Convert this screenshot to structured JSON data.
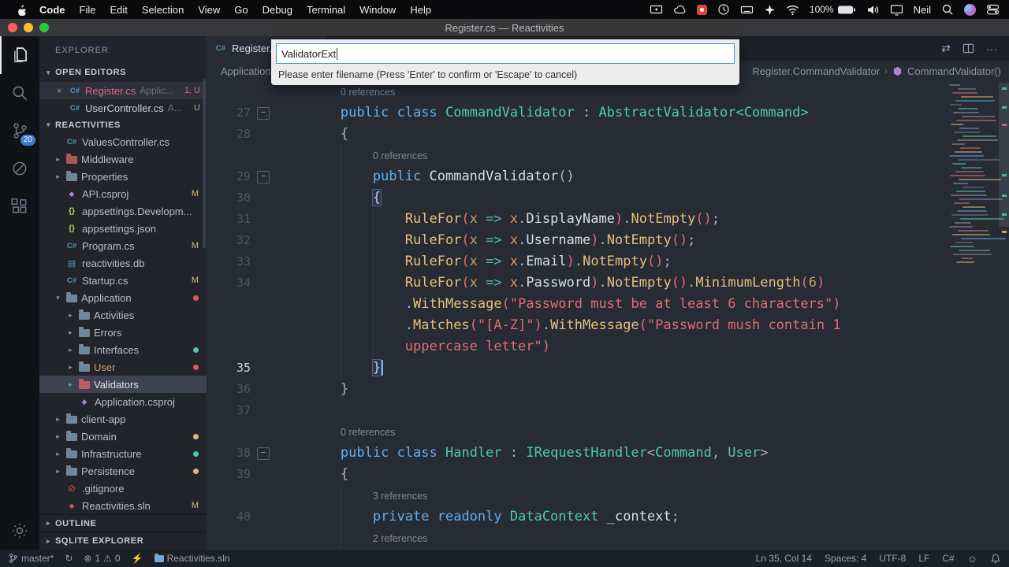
{
  "window": {
    "title": "Register.cs — Reactivities"
  },
  "menu_bar": {
    "items": [
      "Code",
      "File",
      "Edit",
      "Selection",
      "View",
      "Go",
      "Debug",
      "Terminal",
      "Window",
      "Help"
    ],
    "battery": "100%",
    "user": "Neil"
  },
  "activity_bar": {
    "source_control_badge": "20"
  },
  "sidebar": {
    "header": "EXPLORER",
    "sections": {
      "open_editors": "OPEN EDITORS",
      "workspace": "REACTIVITIES",
      "outline": "OUTLINE",
      "sqlite": "SQLITE EXPLORER"
    },
    "open_editors": [
      {
        "label": "Register.cs",
        "desc": "Applic...",
        "badge": "1, U",
        "type": "cs",
        "active": true,
        "color": "#e0697a",
        "badge_color": "#e0697a"
      },
      {
        "label": "UserController.cs",
        "desc": "A...",
        "badge": "U",
        "type": "cs",
        "active": false,
        "badge_color": "#73c991"
      }
    ],
    "tree": [
      {
        "label": "ValuesController.cs",
        "type": "cs",
        "level": 0
      },
      {
        "label": "Middleware",
        "type": "folder",
        "chev": "r",
        "level": 0,
        "ic": "#a9595c"
      },
      {
        "label": "Properties",
        "type": "folder",
        "chev": "r",
        "level": 0
      },
      {
        "label": "API.csproj",
        "type": "csproj",
        "level": 0,
        "badge": "M"
      },
      {
        "label": "appsettings.Developm...",
        "type": "json",
        "level": 0
      },
      {
        "label": "appsettings.json",
        "type": "json",
        "level": 0
      },
      {
        "label": "Program.cs",
        "type": "cs",
        "level": 0,
        "badge": "M"
      },
      {
        "label": "reactivities.db",
        "type": "db",
        "level": 0
      },
      {
        "label": "Startup.cs",
        "type": "cs",
        "level": 0,
        "badge": "M"
      },
      {
        "label": "Application",
        "type": "folder",
        "chev": "d",
        "level": 0,
        "dot": "#e05561"
      },
      {
        "label": "Activities",
        "type": "folder",
        "chev": "r",
        "level": 1
      },
      {
        "label": "Errors",
        "type": "folder",
        "chev": "r",
        "level": 1
      },
      {
        "label": "Interfaces",
        "type": "folder",
        "chev": "r",
        "level": 1,
        "dot": "#4ec9a8"
      },
      {
        "label": "User",
        "type": "folder",
        "chev": "r",
        "level": 1,
        "dot": "#e05561",
        "lc": "#d19a66"
      },
      {
        "label": "Validators",
        "type": "folder",
        "chev": "r",
        "level": 1,
        "sel": true,
        "ic": "#c45c66"
      },
      {
        "label": "Application.csproj",
        "type": "csproj",
        "level": 1
      },
      {
        "label": "client-app",
        "type": "folder",
        "chev": "r",
        "level": 0
      },
      {
        "label": "Domain",
        "type": "folder",
        "chev": "r",
        "level": 0,
        "dot": "#d7ba7d"
      },
      {
        "label": "Infrastructure",
        "type": "folder",
        "chev": "r",
        "level": 0,
        "dot": "#4ec9a8"
      },
      {
        "label": "Persistence",
        "type": "folder",
        "chev": "r",
        "level": 0,
        "dot": "#d7ba7d"
      },
      {
        "label": ".gitignore",
        "type": "git",
        "level": 0
      },
      {
        "label": "Reactivities.sln",
        "type": "sln",
        "level": 0,
        "badge": "M"
      }
    ]
  },
  "editor": {
    "tab": {
      "label": "Register.cs"
    },
    "breadcrumb": {
      "left": "Application",
      "right": "Register.CommandValidator",
      "method": "CommandValidator()"
    },
    "rows": [
      {
        "lens": "0 references",
        "ind": 8
      },
      {
        "n": "27",
        "fold": true,
        "segs": [
          [
            "        ",
            "pu"
          ],
          [
            "public",
            "kw"
          ],
          [
            " ",
            "pu"
          ],
          [
            "class",
            "kw"
          ],
          [
            " ",
            "pu"
          ],
          [
            "CommandValidator",
            "ty"
          ],
          [
            " : ",
            "pu"
          ],
          [
            "AbstractValidator<Command>",
            "ty"
          ]
        ]
      },
      {
        "n": "28",
        "segs": [
          [
            "        {",
            "pu"
          ]
        ]
      },
      {
        "lens": "0 references",
        "ind": 12
      },
      {
        "n": "29",
        "fold": true,
        "segs": [
          [
            "            ",
            "pu"
          ],
          [
            "public",
            "kw"
          ],
          [
            " ",
            "pu"
          ],
          [
            "CommandValidator",
            "tx"
          ],
          [
            "()",
            "pu"
          ]
        ]
      },
      {
        "n": "30",
        "segs": [
          [
            "            ",
            "pu"
          ],
          [
            "{",
            "bm"
          ]
        ]
      },
      {
        "n": "31",
        "segs": [
          [
            "                ",
            "pu"
          ],
          [
            "RuleFor",
            "fn"
          ],
          [
            "(",
            "pr"
          ],
          [
            "x",
            "va"
          ],
          [
            " ",
            "pu"
          ],
          [
            "=>",
            "op"
          ],
          [
            " ",
            "pu"
          ],
          [
            "x",
            "va"
          ],
          [
            ".",
            "pu"
          ],
          [
            "DisplayName",
            "tx"
          ],
          [
            ")",
            "pr"
          ],
          [
            ".",
            "pu"
          ],
          [
            "NotEmpty",
            "fn"
          ],
          [
            "()",
            "pr"
          ],
          [
            ";",
            "pu"
          ]
        ]
      },
      {
        "n": "32",
        "segs": [
          [
            "                ",
            "pu"
          ],
          [
            "RuleFor",
            "fn"
          ],
          [
            "(",
            "pr"
          ],
          [
            "x",
            "va"
          ],
          [
            " ",
            "pu"
          ],
          [
            "=>",
            "op"
          ],
          [
            " ",
            "pu"
          ],
          [
            "x",
            "va"
          ],
          [
            ".",
            "pu"
          ],
          [
            "Username",
            "tx"
          ],
          [
            ")",
            "pr"
          ],
          [
            ".",
            "pu"
          ],
          [
            "NotEmpty",
            "fn"
          ],
          [
            "()",
            "pr"
          ],
          [
            ";",
            "pu"
          ]
        ]
      },
      {
        "n": "33",
        "segs": [
          [
            "                ",
            "pu"
          ],
          [
            "RuleFor",
            "fn"
          ],
          [
            "(",
            "pr"
          ],
          [
            "x",
            "va"
          ],
          [
            " ",
            "pu"
          ],
          [
            "=>",
            "op"
          ],
          [
            " ",
            "pu"
          ],
          [
            "x",
            "va"
          ],
          [
            ".",
            "pu"
          ],
          [
            "Email",
            "tx"
          ],
          [
            ")",
            "pr"
          ],
          [
            ".",
            "pu"
          ],
          [
            "NotEmpty",
            "fn"
          ],
          [
            "()",
            "pr"
          ],
          [
            ";",
            "pu"
          ]
        ]
      },
      {
        "n": "34",
        "segs": [
          [
            "                ",
            "pu"
          ],
          [
            "RuleFor",
            "fn"
          ],
          [
            "(",
            "pr"
          ],
          [
            "x",
            "va"
          ],
          [
            " ",
            "pu"
          ],
          [
            "=>",
            "op"
          ],
          [
            " ",
            "pu"
          ],
          [
            "x",
            "va"
          ],
          [
            ".",
            "pu"
          ],
          [
            "Password",
            "tx"
          ],
          [
            ")",
            "pr"
          ],
          [
            ".",
            "pu"
          ],
          [
            "NotEmpty",
            "fn"
          ],
          [
            "()",
            "pr"
          ],
          [
            ".",
            "pu"
          ],
          [
            "MinimumLength",
            "fn"
          ],
          [
            "(",
            "pr"
          ],
          [
            "6",
            "nu"
          ],
          [
            ")",
            "pr"
          ]
        ]
      },
      {
        "segs": [
          [
            "                ",
            "pu"
          ],
          [
            ".",
            "pu"
          ],
          [
            "WithMessage",
            "fn"
          ],
          [
            "(",
            "pr"
          ],
          [
            "\"Password must be at least 6 characters\"",
            "st"
          ],
          [
            ")",
            "pr"
          ]
        ]
      },
      {
        "segs": [
          [
            "                ",
            "pu"
          ],
          [
            ".",
            "pu"
          ],
          [
            "Matches",
            "fn"
          ],
          [
            "(",
            "pr"
          ],
          [
            "\"[A-Z]\"",
            "st"
          ],
          [
            ")",
            "pr"
          ],
          [
            ".",
            "pu"
          ],
          [
            "WithMessage",
            "fn"
          ],
          [
            "(",
            "pr"
          ],
          [
            "\"Password mush contain 1",
            "st"
          ]
        ]
      },
      {
        "segs": [
          [
            "                ",
            "pu"
          ],
          [
            "uppercase letter\"",
            "st"
          ],
          [
            ")",
            "pr"
          ]
        ]
      },
      {
        "n": "35",
        "active": true,
        "seg_note": "cursor at col 14",
        "segs": [
          [
            "            ",
            "pu"
          ],
          [
            "}",
            "bm"
          ],
          [
            "",
            "cur"
          ]
        ]
      },
      {
        "n": "36",
        "segs": [
          [
            "        }",
            "pu"
          ]
        ]
      },
      {
        "n": "37",
        "segs": []
      },
      {
        "lens": "0 references",
        "ind": 8
      },
      {
        "n": "38",
        "fold": true,
        "segs": [
          [
            "        ",
            "pu"
          ],
          [
            "public",
            "kw"
          ],
          [
            " ",
            "pu"
          ],
          [
            "class",
            "kw"
          ],
          [
            " ",
            "pu"
          ],
          [
            "Handler",
            "ty"
          ],
          [
            " : ",
            "pu"
          ],
          [
            "IRequestHandler",
            "ty"
          ],
          [
            "<",
            "pu"
          ],
          [
            "Command",
            "ty"
          ],
          [
            ", ",
            "pu"
          ],
          [
            "User",
            "ty"
          ],
          [
            ">",
            "pu"
          ]
        ]
      },
      {
        "n": "39",
        "segs": [
          [
            "        {",
            "pu"
          ]
        ]
      },
      {
        "lens": "3 references",
        "ind": 12
      },
      {
        "n": "40",
        "segs": [
          [
            "            ",
            "pu"
          ],
          [
            "private",
            "kw"
          ],
          [
            " ",
            "pu"
          ],
          [
            "readonly",
            "kw"
          ],
          [
            " ",
            "pu"
          ],
          [
            "DataContext",
            "ty"
          ],
          [
            " ",
            "pu"
          ],
          [
            "_context",
            "tx"
          ],
          [
            ";",
            "pu"
          ]
        ]
      },
      {
        "lens": "2 references",
        "ind": 12
      }
    ]
  },
  "quick_input": {
    "value": "ValidatorExt",
    "prompt": "Please enter filename (Press 'Enter' to confirm or 'Escape' to cancel)"
  },
  "status_bar": {
    "branch": "master*",
    "errors": "1",
    "warnings": "0",
    "solution": "Reactivities.sln",
    "line_col": "Ln 35, Col 14",
    "spaces": "Spaces: 4",
    "encoding": "UTF-8",
    "eol": "LF",
    "lang": "C#"
  }
}
